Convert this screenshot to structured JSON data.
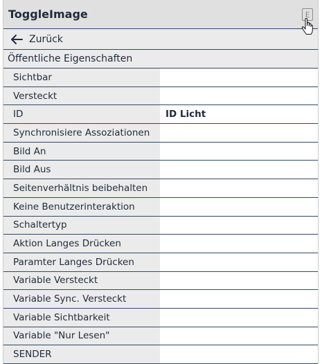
{
  "header": {
    "title": "ToggleImage",
    "edit_icon_letter": "E"
  },
  "nav": {
    "back_label": "Zurück"
  },
  "section": {
    "title": "Öffentliche Eigenschaften"
  },
  "properties": [
    {
      "label": "Sichtbar",
      "value": ""
    },
    {
      "label": "Versteckt",
      "value": ""
    },
    {
      "label": "ID",
      "value": "ID Licht"
    },
    {
      "label": "Synchronisiere Assoziationen",
      "value": ""
    },
    {
      "label": "Bild An",
      "value": ""
    },
    {
      "label": "Bild Aus",
      "value": ""
    },
    {
      "label": "Seitenverhältnis beibehalten",
      "value": ""
    },
    {
      "label": "Keine Benutzerinteraktion",
      "value": ""
    },
    {
      "label": "Schaltertyp",
      "value": ""
    },
    {
      "label": "Aktion Langes Drücken",
      "value": ""
    },
    {
      "label": "Paramter Langes Drücken",
      "value": ""
    },
    {
      "label": "Variable Versteckt",
      "value": ""
    },
    {
      "label": "Variable Sync. Versteckt",
      "value": ""
    },
    {
      "label": "Variable Sichtbarkeit",
      "value": ""
    },
    {
      "label": "Variable \"Nur Lesen\"",
      "value": ""
    },
    {
      "label": "SENDER",
      "value": ""
    }
  ],
  "colors": {
    "border": "#2e4a68",
    "label_bg": "#ebebeb",
    "header_bg": "#e0e0e0",
    "text": "#1e2b3b"
  }
}
